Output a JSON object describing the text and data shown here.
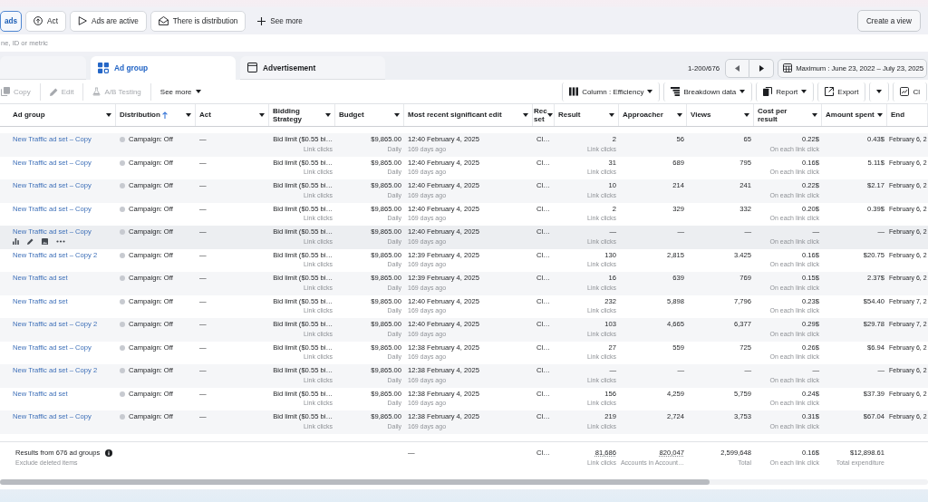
{
  "filter_bar": {
    "chips": [
      {
        "label": "ads",
        "selected": true
      },
      {
        "label": "Act",
        "selected": false
      },
      {
        "label": "Ads are active",
        "selected": false
      },
      {
        "label": "There is distribution",
        "selected": false
      }
    ],
    "see_more": "See more",
    "create_view": "Create a view"
  },
  "search": {
    "placeholder": "ne, ID or metric"
  },
  "tabs": [
    {
      "selected": false
    },
    {
      "label": "Ad group",
      "selected": true
    },
    {
      "label": "Advertisement",
      "selected": false
    }
  ],
  "pager": {
    "range": "1-200/676",
    "date_range": "Maximum : June 23, 2022 – July 23, 2025"
  },
  "toolbar": {
    "left": [
      {
        "label": "Copy",
        "disabled": true,
        "menu": false
      },
      {
        "label": "Edit",
        "disabled": true,
        "menu": false
      },
      {
        "label": "A/B Testing",
        "disabled": true,
        "menu": false
      },
      {
        "label": "See more",
        "disabled": false,
        "menu": true
      }
    ],
    "right": [
      {
        "label": "Column : Efficiency",
        "menu": true
      },
      {
        "label": "Breakdown data",
        "menu": true
      },
      {
        "label": "Report",
        "menu": true
      },
      {
        "label": "Export",
        "menu": false
      },
      {
        "menu": true
      },
      {
        "label": "Cl",
        "menu": false
      }
    ]
  },
  "table": {
    "columns": [
      {
        "label": "Ad group",
        "sorted": false,
        "menu": true
      },
      {
        "label": "Distribution",
        "sorted": true,
        "menu": true
      },
      {
        "label": "Act",
        "sorted": false,
        "menu": true
      },
      {
        "label": "Bidding Strategy",
        "sorted": false,
        "menu": true
      },
      {
        "label": "Budget",
        "sorted": false,
        "menu": true
      },
      {
        "label": "Most recent significant edit",
        "sorted": false,
        "menu": true
      },
      {
        "label": "Rec set",
        "sorted": false,
        "menu": true
      },
      {
        "label": "Result",
        "sorted": false,
        "menu": true
      },
      {
        "label": "Approacher",
        "sorted": false,
        "menu": true
      },
      {
        "label": "Views",
        "sorted": false,
        "menu": true
      },
      {
        "label": "Cost per result",
        "sorted": false,
        "menu": true
      },
      {
        "label": "Amount spent",
        "sorted": false,
        "menu": true
      },
      {
        "label": "End",
        "sorted": false,
        "menu": false
      }
    ],
    "rows": [
      {
        "name": "New Traffic ad set – Copy",
        "hovered": false,
        "delivery": "Campaign: Off",
        "act": "—",
        "bid_strategy": "Bid limit ($0.55 bi…",
        "bid_event": "Link clicks",
        "budget": "$9,865.00",
        "budget_period": "Daily",
        "last_edit": "12:40 February 4, 2025",
        "last_edit_age": "169 days ago",
        "rec": "Cl…",
        "result": "2",
        "result_type": "Link clicks",
        "approacher": "56",
        "views": "65",
        "cost_per_result": "0.22$",
        "cost_basis": "On each link click",
        "amount_spent": "0.43$",
        "end": "February 6, 2"
      },
      {
        "name": "New Traffic ad set – Copy",
        "hovered": false,
        "delivery": "Campaign: Off",
        "act": "—",
        "bid_strategy": "Bid limit ($0.55 bi…",
        "bid_event": "Link clicks",
        "budget": "$9,865.00",
        "budget_period": "Daily",
        "last_edit": "12:40 February 4, 2025",
        "last_edit_age": "169 days ago",
        "rec": "Cl…",
        "result": "31",
        "result_type": "Link clicks",
        "approacher": "689",
        "views": "795",
        "cost_per_result": "0.16$",
        "cost_basis": "On each link click",
        "amount_spent": "5.11$",
        "end": "February 6, 2"
      },
      {
        "name": "New Traffic ad set – Copy",
        "hovered": false,
        "delivery": "Campaign: Off",
        "act": "—",
        "bid_strategy": "Bid limit ($0.55 bi…",
        "bid_event": "Link clicks",
        "budget": "$9,865.00",
        "budget_period": "Daily",
        "last_edit": "12:40 February 4, 2025",
        "last_edit_age": "169 days ago",
        "rec": "Cl…",
        "result": "10",
        "result_type": "Link clicks",
        "approacher": "214",
        "views": "241",
        "cost_per_result": "0.22$",
        "cost_basis": "On each link click",
        "amount_spent": "$2.17",
        "end": "February 6, 2"
      },
      {
        "name": "New Traffic ad set – Copy",
        "hovered": false,
        "delivery": "Campaign: Off",
        "act": "—",
        "bid_strategy": "Bid limit ($0.55 bi…",
        "bid_event": "Link clicks",
        "budget": "$9,865.00",
        "budget_period": "Daily",
        "last_edit": "12:40 February 4, 2025",
        "last_edit_age": "169 days ago",
        "rec": "Cl…",
        "result": "2",
        "result_type": "Link clicks",
        "approacher": "329",
        "views": "332",
        "cost_per_result": "0.20$",
        "cost_basis": "On each link click",
        "amount_spent": "0.39$",
        "end": "February 6, 2"
      },
      {
        "name": "New Traffic ad set – Copy",
        "hovered": true,
        "delivery": "Campaign: Off",
        "act": "—",
        "bid_strategy": "Bid limit ($0.55 bi…",
        "bid_event": "Link clicks",
        "budget": "$9,865.00",
        "budget_period": "Daily",
        "last_edit": "12:40 February 4, 2025",
        "last_edit_age": "169 days ago",
        "rec": "Cl…",
        "result": "—",
        "result_type": "Link clicks",
        "approacher": "—",
        "views": "—",
        "cost_per_result": "—",
        "cost_basis": "On each link click",
        "amount_spent": "—",
        "end": "February 6, 2"
      },
      {
        "name": "New Traffic ad set – Copy 2",
        "hovered": false,
        "delivery": "Campaign: Off",
        "act": "—",
        "bid_strategy": "Bid limit ($0.55 bi…",
        "bid_event": "Link clicks",
        "budget": "$9,865.00",
        "budget_period": "Daily",
        "last_edit": "12:39 February 4, 2025",
        "last_edit_age": "169 days ago",
        "rec": "Cl…",
        "result": "130",
        "result_type": "Link clicks",
        "approacher": "2,815",
        "views": "3.425",
        "cost_per_result": "0.16$",
        "cost_basis": "On each link click",
        "amount_spent": "$20.75",
        "end": "February 6, 2"
      },
      {
        "name": "New Traffic ad set",
        "hovered": false,
        "delivery": "Campaign: Off",
        "act": "—",
        "bid_strategy": "Bid limit ($0.55 bi…",
        "bid_event": "Link clicks",
        "budget": "$9,865.00",
        "budget_period": "Daily",
        "last_edit": "12:39 February 4, 2025",
        "last_edit_age": "169 days ago",
        "rec": "Cl…",
        "result": "16",
        "result_type": "Link clicks",
        "approacher": "639",
        "views": "769",
        "cost_per_result": "0.15$",
        "cost_basis": "On each link click",
        "amount_spent": "2.37$",
        "end": "February 6, 2"
      },
      {
        "name": "New Traffic ad set",
        "hovered": false,
        "delivery": "Campaign: Off",
        "act": "—",
        "bid_strategy": "Bid limit ($0.55 bi…",
        "bid_event": "Link clicks",
        "budget": "$9,865.00",
        "budget_period": "Daily",
        "last_edit": "12:40 February 4, 2025",
        "last_edit_age": "169 days ago",
        "rec": "Cl…",
        "result": "232",
        "result_type": "Link clicks",
        "approacher": "5,898",
        "views": "7,796",
        "cost_per_result": "0.23$",
        "cost_basis": "On each link click",
        "amount_spent": "$54.40",
        "end": "February 7, 2"
      },
      {
        "name": "New Traffic ad set – Copy 2",
        "hovered": false,
        "delivery": "Campaign: Off",
        "act": "—",
        "bid_strategy": "Bid limit ($0.55 bi…",
        "bid_event": "Link clicks",
        "budget": "$9,865.00",
        "budget_period": "Daily",
        "last_edit": "12:40 February 4, 2025",
        "last_edit_age": "169 days ago",
        "rec": "Cl…",
        "result": "103",
        "result_type": "Link clicks",
        "approacher": "4,665",
        "views": "6,377",
        "cost_per_result": "0.29$",
        "cost_basis": "On each link click",
        "amount_spent": "$29.78",
        "end": "February 7, 2"
      },
      {
        "name": "New Traffic ad set – Copy",
        "hovered": false,
        "delivery": "Campaign: Off",
        "act": "—",
        "bid_strategy": "Bid limit ($0.55 bi…",
        "bid_event": "Link clicks",
        "budget": "$9,865.00",
        "budget_period": "Daily",
        "last_edit": "12:38 February 4, 2025",
        "last_edit_age": "169 days ago",
        "rec": "Cl…",
        "result": "27",
        "result_type": "Link clicks",
        "approacher": "559",
        "views": "725",
        "cost_per_result": "0.26$",
        "cost_basis": "On each link click",
        "amount_spent": "$6.94",
        "end": "February 6, 2"
      },
      {
        "name": "New Traffic ad set – Copy 2",
        "hovered": false,
        "delivery": "Campaign: Off",
        "act": "—",
        "bid_strategy": "Bid limit ($0.55 bi…",
        "bid_event": "Link clicks",
        "budget": "$9,865.00",
        "budget_period": "Daily",
        "last_edit": "12:38 February 4, 2025",
        "last_edit_age": "169 days ago",
        "rec": "Cl…",
        "result": "—",
        "result_type": "Link clicks",
        "approacher": "—",
        "views": "—",
        "cost_per_result": "—",
        "cost_basis": "On each link click",
        "amount_spent": "—",
        "end": "February 6, 2"
      },
      {
        "name": "New Traffic ad set",
        "hovered": false,
        "delivery": "Campaign: Off",
        "act": "—",
        "bid_strategy": "Bid limit ($0.55 bi…",
        "bid_event": "Link clicks",
        "budget": "$9,865.00",
        "budget_period": "Daily",
        "last_edit": "12:38 February 4, 2025",
        "last_edit_age": "169 days ago",
        "rec": "Cl…",
        "result": "156",
        "result_type": "Link clicks",
        "approacher": "4,259",
        "views": "5,759",
        "cost_per_result": "0.24$",
        "cost_basis": "On each link click",
        "amount_spent": "$37.39",
        "end": "February 6, 2"
      },
      {
        "name": "New Traffic ad set – Copy",
        "hovered": false,
        "delivery": "Campaign: Off",
        "act": "—",
        "bid_strategy": "Bid limit ($0.55 bi…",
        "bid_event": "Link clicks",
        "budget": "$9,865.00",
        "budget_period": "Daily",
        "last_edit": "12:38 February 4, 2025",
        "last_edit_age": "169 days ago",
        "rec": "Cl…",
        "result": "219",
        "result_type": "Link clicks",
        "approacher": "2,724",
        "views": "3,753",
        "cost_per_result": "0.31$",
        "cost_basis": "On each link click",
        "amount_spent": "$67.04",
        "end": "February 6, 2"
      }
    ],
    "summary": {
      "title": "Results from 676 ad groups",
      "note": "Exclude deleted items",
      "last_edit": "—",
      "rec": "Cl…",
      "result": "81,686",
      "result_type": "Link clicks",
      "approacher": "820,047",
      "approacher_note": "Accounts in Account…",
      "views": "2,599,648",
      "views_note": "Total",
      "cost_per_result": "0.16$",
      "cost_basis": "On each link click",
      "amount_spent": "$12,898.61",
      "amount_note": "Total expenditure"
    }
  }
}
